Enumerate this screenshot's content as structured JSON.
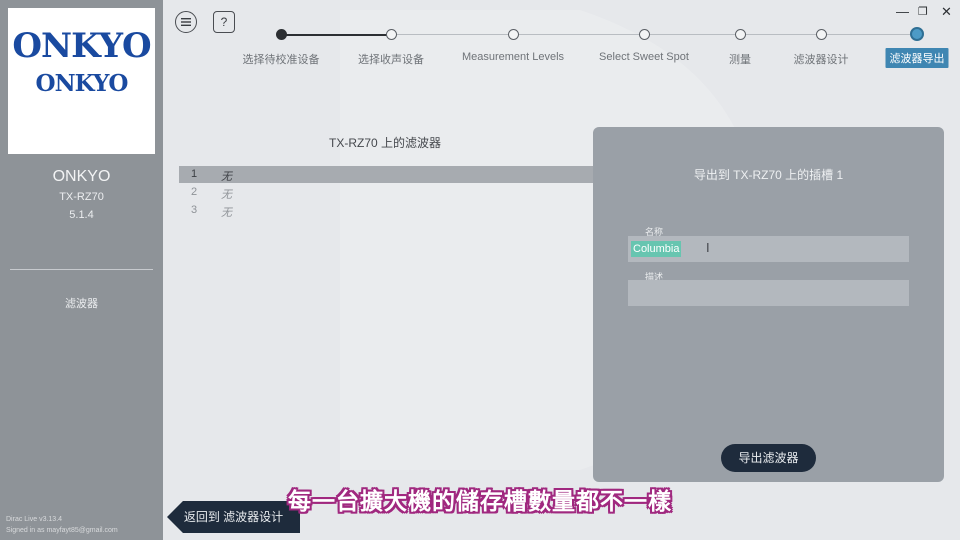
{
  "sidebar": {
    "logo_text": "ONKYO",
    "device_name": "ONKYO",
    "device_model": "TX-RZ70",
    "speaker_config": "5.1.4",
    "nav_item": "滤波器",
    "version": "Dirac Live v3.13.4",
    "signed_in": "Signed in as mayfayt85@gmail.com"
  },
  "toolbar": {
    "menu_icon": "menu-icon",
    "help_label": "?"
  },
  "stepper": {
    "steps": [
      {
        "label": "选择待校准设备",
        "state": "done"
      },
      {
        "label": "选择收声设备",
        "state": "upcoming"
      },
      {
        "label": "Measurement Levels",
        "state": "upcoming"
      },
      {
        "label": "Select Sweet Spot",
        "state": "upcoming"
      },
      {
        "label": "测量",
        "state": "upcoming"
      },
      {
        "label": "滤波器设计",
        "state": "upcoming"
      },
      {
        "label": "滤波器导出",
        "state": "active"
      }
    ],
    "active_color": "#3f86b2"
  },
  "window_controls": {
    "minimize": "—",
    "restore": "❐",
    "close": "✕"
  },
  "filter_list": {
    "title": "TX-RZ70 上的滤波器",
    "rows": [
      {
        "num": "1",
        "name": "无"
      },
      {
        "num": "2",
        "name": "无"
      },
      {
        "num": "3",
        "name": "无"
      }
    ]
  },
  "export_panel": {
    "title": "导出到 TX-RZ70 上的插槽 1",
    "name_label": "名称",
    "name_value": "Columbia",
    "description_label": "描述",
    "description_value": "",
    "export_button": "导出滤波器"
  },
  "back_button": "返回到 滤波器设计",
  "subtitle": "每一台擴大機的儲存槽數量都不一樣"
}
